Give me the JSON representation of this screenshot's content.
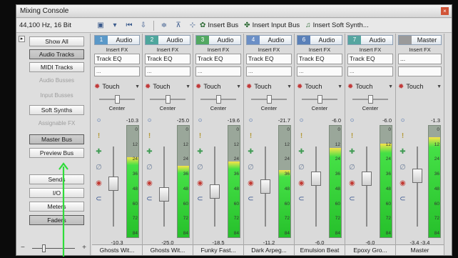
{
  "window": {
    "title": "Mixing Console",
    "close_glyph": "×"
  },
  "toolbar": {
    "sample_rate": "44,100 Hz, 16 Bit",
    "insert_bus": "Insert Bus",
    "insert_input_bus": "Insert Input Bus",
    "insert_soft_synth": "Insert Soft Synth..."
  },
  "left_panel": {
    "collapse_glyph": "▸",
    "show_all": "Show All",
    "audio_tracks": "Audio Tracks",
    "midi_tracks": "MIDI Tracks",
    "audio_busses": "Audio Busses",
    "input_busses": "Input Busses",
    "soft_synths": "Soft Synths",
    "assignable_fx": "Assignable FX",
    "master_bus": "Master Bus",
    "preview_bus": "Preview Bus",
    "sends": "Sends",
    "io": "I/O",
    "meters": "Meters",
    "faders": "Faders",
    "zoom_out_glyph": "−",
    "zoom_in_glyph": "+"
  },
  "strips": [
    {
      "num": "1",
      "label": "Audio",
      "insert_fx": "Insert FX",
      "slot1": "Track EQ",
      "slot2": "...",
      "automation": "Touch",
      "pan": "Center",
      "peak": "-10.3",
      "volume": "-10.3",
      "name": "Ghosts Wit...",
      "color": "#5a98c8",
      "level": 0.72,
      "fader": 0.46
    },
    {
      "num": "2",
      "label": "Audio",
      "insert_fx": "Insert FX",
      "slot1": "Track EQ",
      "slot2": "...",
      "automation": "Touch",
      "pan": "Center",
      "peak": "-25.0",
      "volume": "-25.0",
      "name": "Ghosts Wit...",
      "color": "#4ea69c",
      "level": 0.64,
      "fader": 0.62
    },
    {
      "num": "3",
      "label": "Audio",
      "insert_fx": "Insert FX",
      "slot1": "Track EQ",
      "slot2": "...",
      "automation": "Touch",
      "pan": "Center",
      "peak": "-19.6",
      "volume": "-18.5",
      "name": "Funky Fast...",
      "color": "#52a862",
      "level": 0.68,
      "fader": 0.58
    },
    {
      "num": "4",
      "label": "Audio",
      "insert_fx": "Insert FX",
      "slot1": "Track EQ",
      "slot2": "...",
      "automation": "Touch",
      "pan": "Center",
      "peak": "-21.7",
      "volume": "-11.2",
      "name": "Dark Arpeg...",
      "color": "#6b8fc6",
      "level": 0.6,
      "fader": 0.5
    },
    {
      "num": "6",
      "label": "Audio",
      "insert_fx": "Insert FX",
      "slot1": "Track EQ",
      "slot2": "...",
      "automation": "Touch",
      "pan": "Center",
      "peak": "-6.0",
      "volume": "-6.0",
      "name": "Emulsion Beat",
      "color": "#5a80b8",
      "level": 0.8,
      "fader": 0.38
    },
    {
      "num": "7",
      "label": "Audio",
      "insert_fx": "Insert FX",
      "slot1": "Track EQ",
      "slot2": "...",
      "automation": "Touch",
      "pan": "Center",
      "peak": "-6.0",
      "volume": "-6.0",
      "name": "Epoxy Gro...",
      "color": "#56a5a0",
      "level": 0.84,
      "fader": 0.38
    },
    {
      "num": "",
      "label": "Master",
      "insert_fx": "Insert FX",
      "slot1": "...",
      "slot2": "",
      "automation": "Touch",
      "pan": "",
      "peak": "-1.3",
      "volume": "-3.4 -3.4",
      "name": "Master",
      "color": "#9a9a9a",
      "level": 0.9,
      "fader": 0.34
    }
  ],
  "meter_ticks": [
    "0",
    "12",
    "24",
    "36",
    "48",
    "60",
    "72",
    "84"
  ],
  "colors": {
    "annotation_arrow": "#2fdc3a",
    "meter_green": "#26c02b"
  }
}
